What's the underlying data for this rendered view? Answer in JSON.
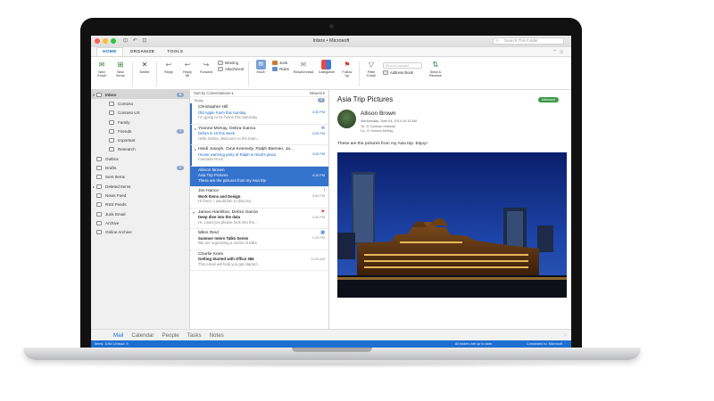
{
  "window": {
    "title": "Inbox • Microsoft",
    "quick_access": "⊡ ↶ ⊡",
    "search_placeholder": "Search This Folder"
  },
  "ribbon": {
    "tabs": [
      "HOME",
      "ORGANIZE",
      "TOOLS"
    ],
    "buttons": {
      "new_email": "New\nEmail",
      "new_items": "New\nItems",
      "delete": "Delete",
      "reply": "Reply",
      "reply_all": "Reply\nAll",
      "forward": "Forward",
      "meeting": "Meeting",
      "attachment": "Attachment",
      "move": "Move",
      "junk": "Junk",
      "rules": "Rules",
      "read_unread": "Read/Unread",
      "categorize": "Categorize",
      "follow_up": "Follow\nUp",
      "filter_email": "Filter\nEmail",
      "find_contact": "Find a Contact",
      "address_book": "Address Book",
      "send_receive": "Send &\nReceive"
    },
    "right_controls": "⌃  ☺"
  },
  "folders": [
    {
      "label": "Inbox",
      "count": "5",
      "level": "top",
      "selected": true,
      "caret": "▾"
    },
    {
      "label": "Contoso",
      "level": "sub"
    },
    {
      "label": "Contoso UX",
      "level": "sub"
    },
    {
      "label": "Family",
      "level": "sub"
    },
    {
      "label": "Friends",
      "count": "3",
      "level": "sub"
    },
    {
      "label": "Important",
      "level": "sub"
    },
    {
      "label": "Research",
      "level": "sub"
    },
    {
      "label": "Outbox",
      "level": "top"
    },
    {
      "label": "Drafts",
      "count": "3",
      "level": "top"
    },
    {
      "label": "Sent Items",
      "level": "top"
    },
    {
      "label": "Deleted Items",
      "level": "top",
      "caret": "▸"
    },
    {
      "label": "News Feed",
      "level": "top"
    },
    {
      "label": "RSS Feeds",
      "level": "top"
    },
    {
      "label": "Junk Email",
      "level": "top"
    },
    {
      "label": "Archive",
      "level": "top"
    },
    {
      "label": "Online Archive",
      "level": "top"
    }
  ],
  "list": {
    "sort_label": "Sort by Conversations ▾",
    "order_label": "Newest ▾",
    "group_label": "Today",
    "group_count": "5",
    "messages": [
      {
        "from": "Christopher Hill",
        "subject": "Old Apple Farm this Sunday",
        "preview": "I'm going to be home this Saturday",
        "time": "4:30 PM",
        "unread": true,
        "flag": ""
      },
      {
        "from": "Yvonne McKay, Debra Garcia",
        "subject": "Debra is 10 this week",
        "preview": "Hello Debra, Welcome to the team...",
        "time": "4:20 PM",
        "unread": true,
        "flag": "✉",
        "thread": "▸"
      },
      {
        "from": "Heidi Joseph, Gina Kennedy, Ralph Bieman, Ja...",
        "subject": "House warming party at Ralph & Heidi's place",
        "preview": "Cascade Rock",
        "time": "4:09 PM",
        "unread": true,
        "flag": "",
        "thread": "▸"
      },
      {
        "from": "Allison Brown",
        "subject": "Asia Trip Pictures",
        "preview": "These are the pictures from my Asia trip",
        "time": "4:10 PM",
        "selected": true,
        "flag": ""
      },
      {
        "from": "Jim Hance",
        "subject": "Work Items and Design",
        "preview": "Hi there, I would like to discuss...",
        "time": "3:50 PM",
        "flag": "!"
      },
      {
        "from": "James Hamilton, Debra Garcia",
        "subject": "Deep dive into the data",
        "preview": "Hi, could you please look into the...",
        "time": "2:40 PM",
        "flag": "⚑",
        "thread": "▾"
      },
      {
        "from": "Miles Reid",
        "subject": "Summer Intern Talks Series",
        "preview": "We are organizing a series of talks",
        "time": "1:20 PM",
        "flag": "▦"
      },
      {
        "from": "Charlie Keen",
        "subject": "Getting Started with Office 365",
        "preview": "This email will help you get started...",
        "time": "11:03 AM",
        "flag": ""
      }
    ]
  },
  "reading": {
    "subject": "Asia Trip Pictures",
    "tag": "Inforward",
    "from": "Allison Brown",
    "date": "Wednesday, June 04, 2014 10:15 AM",
    "to": "To: ⊙ Contoso Infomail",
    "cc": "Cc: ⊙ Yvonne McKay",
    "body": "These are the pictures from my Asia trip.  Enjoy!"
  },
  "nav": {
    "items": [
      "Mail",
      "Calendar",
      "People",
      "Tasks",
      "Notes"
    ],
    "active": "Mail",
    "more": "›"
  },
  "status": {
    "left": "Items: 1064     Unread: 5",
    "middle": "All folders are up to date.",
    "right": "Connected to: Microsoft"
  },
  "colors": {
    "accent": "#1f6fd0",
    "selected_row": "#3473ce",
    "tag_green": "#3c9a48"
  }
}
